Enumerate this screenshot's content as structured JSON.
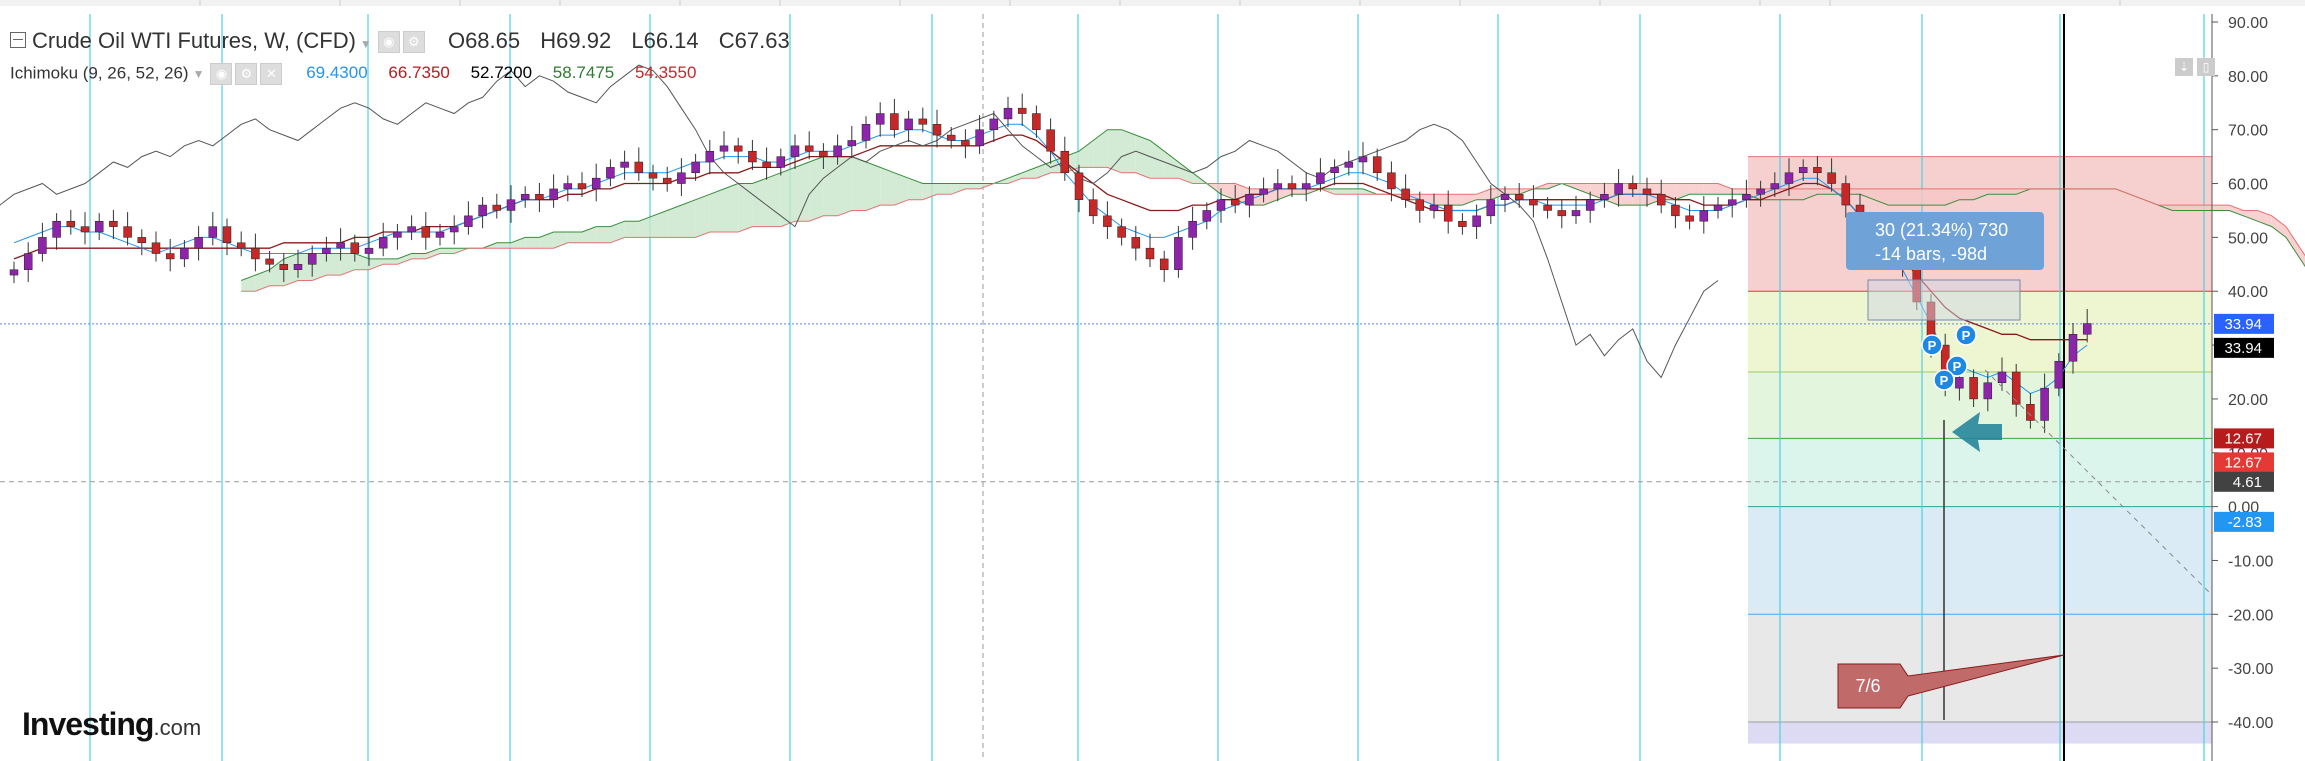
{
  "header": {
    "symbol_title": "Crude Oil WTI Futures, W, (CFD)",
    "ohlc": [
      {
        "key": "O",
        "value": "68.65"
      },
      {
        "key": "H",
        "value": "69.92"
      },
      {
        "key": "L",
        "value": "66.14"
      },
      {
        "key": "C",
        "value": "67.63"
      }
    ]
  },
  "indicator": {
    "name": "Ichimoku (9, 26, 52, 26)",
    "values": [
      {
        "value": "69.4300",
        "color": "#2196f3"
      },
      {
        "value": "66.7350",
        "color": "#b71c1c"
      },
      {
        "value": "52.7200",
        "color": "#000000"
      },
      {
        "value": "58.7475",
        "color": "#2e7d32"
      },
      {
        "value": "54.3550",
        "color": "#c62828"
      }
    ]
  },
  "brand": {
    "name": "Investing",
    "suffix": ".com"
  },
  "measure_label": {
    "line1": "30 (21.34%) 730",
    "line2": "-14 bars, -98d"
  },
  "callout": {
    "text": "7/6"
  },
  "markers": [
    "P",
    "P",
    "P",
    "P"
  ],
  "price_badges": [
    {
      "text": "33.94",
      "bg": "#2962ff",
      "value": 33.94,
      "offset": 0
    },
    {
      "text": "33.94",
      "bg": "#000000",
      "value": 33.94,
      "offset": 1
    },
    {
      "text": "12.67",
      "bg": "#b71c1c",
      "value": 12.67,
      "offset": 0
    },
    {
      "text": "12.67",
      "bg": "#e53935",
      "value": 12.67,
      "offset": 1
    },
    {
      "text": "4.61",
      "bg": "#424242",
      "value": 4.61,
      "offset": 0
    },
    {
      "text": "-2.83",
      "bg": "#2196f3",
      "value": -2.83,
      "offset": 0
    }
  ],
  "colors": {
    "bull": "#8e24aa",
    "bear": "#c62828",
    "tenkan": "#2196f3",
    "kijun": "#8b1a1a",
    "chikou": "#555555",
    "span_a": "#388e3c",
    "span_b": "#e57373",
    "cloud_bull": "#c8e6c9",
    "cloud_bear": "#f8c6c6",
    "cyan_lines": "#4dd0e1"
  },
  "chart_data": {
    "type": "candlestick",
    "title": "Crude Oil WTI Futures, W, (CFD)",
    "y_axis_side": "right",
    "ylim": [
      -44,
      91
    ],
    "yticks": [
      "90.00",
      "80.00",
      "70.00",
      "60.00",
      "50.00",
      "40.00",
      "30.00",
      "20.00",
      "10.00",
      "0.00",
      "-10.00",
      "-20.00",
      "-30.00",
      "-40.00"
    ],
    "close_series": [
      44,
      47,
      50,
      53,
      52,
      51,
      53,
      52,
      50,
      49,
      47,
      46,
      48,
      50,
      52,
      49,
      48,
      46,
      45,
      44,
      45,
      47,
      48,
      49,
      47,
      48,
      50,
      51,
      52,
      50,
      51,
      52,
      54,
      56,
      55,
      57,
      58,
      57,
      59,
      60,
      59,
      61,
      63,
      64,
      62,
      61,
      60,
      62,
      64,
      66,
      67,
      66,
      64,
      63,
      65,
      67,
      66,
      65,
      67,
      68,
      71,
      73,
      70,
      72,
      71,
      69,
      68,
      67,
      70,
      72,
      74,
      73,
      70,
      66,
      62,
      57,
      54,
      52,
      50,
      48,
      46,
      44,
      50,
      53,
      55,
      57,
      56,
      58,
      59,
      60,
      59,
      60,
      62,
      63,
      64,
      65,
      62,
      59,
      57,
      55,
      56,
      53,
      52,
      54,
      57,
      58,
      57,
      56,
      55,
      54,
      55,
      57,
      58,
      60,
      59,
      58,
      56,
      54,
      53,
      55,
      56,
      57,
      58,
      59,
      60,
      62,
      63,
      62,
      60,
      56,
      52,
      50,
      48,
      45,
      38,
      30,
      22,
      24,
      20,
      23,
      25,
      19,
      16,
      22,
      27,
      32,
      34
    ],
    "tenkan": [
      49,
      50,
      51,
      52,
      52,
      51,
      51,
      50,
      49,
      48,
      47,
      48,
      49,
      50,
      50,
      49,
      48,
      47,
      47,
      47,
      47,
      48,
      48,
      48,
      48,
      49,
      50,
      51,
      51,
      51,
      51,
      52,
      53,
      54,
      55,
      56,
      57,
      57,
      58,
      59,
      59,
      60,
      61,
      62,
      62,
      62,
      62,
      63,
      64,
      64,
      65,
      65,
      65,
      64,
      64,
      65,
      66,
      66,
      66,
      67,
      68,
      69,
      69,
      70,
      70,
      69,
      68,
      68,
      69,
      70,
      71,
      71,
      69,
      66,
      62,
      59,
      56,
      54,
      52,
      51,
      50,
      50,
      51,
      52,
      53,
      55,
      56,
      57,
      58,
      59,
      59,
      59,
      60,
      61,
      62,
      62,
      61,
      60,
      58,
      57,
      56,
      55,
      55,
      55,
      56,
      56,
      57,
      57,
      56,
      56,
      56,
      56,
      57,
      58,
      58,
      58,
      57,
      56,
      55,
      55,
      55,
      56,
      57,
      58,
      59,
      60,
      61,
      61,
      59,
      57,
      54,
      51,
      48,
      44,
      39,
      34,
      28,
      26,
      25,
      24,
      25,
      23,
      21,
      22,
      24,
      28,
      30
    ],
    "kijun": [
      46,
      47,
      48,
      48,
      48,
      48,
      48,
      48,
      48,
      48,
      48,
      48,
      48,
      48,
      48,
      48,
      48,
      48,
      48,
      49,
      49,
      49,
      49,
      49,
      50,
      50,
      51,
      51,
      51,
      52,
      52,
      52,
      53,
      54,
      55,
      56,
      57,
      57,
      57,
      58,
      58,
      59,
      59,
      60,
      60,
      60,
      60,
      61,
      61,
      62,
      62,
      62,
      63,
      63,
      63,
      64,
      65,
      65,
      65,
      65,
      66,
      67,
      67,
      67,
      67,
      67,
      67,
      67,
      67,
      68,
      69,
      69,
      68,
      66,
      64,
      62,
      60,
      58,
      57,
      56,
      55,
      55,
      55,
      56,
      56,
      57,
      57,
      58,
      58,
      59,
      59,
      59,
      59,
      60,
      60,
      60,
      59,
      58,
      57,
      56,
      55,
      55,
      55,
      55,
      56,
      56,
      57,
      57,
      57,
      57,
      57,
      57,
      57,
      58,
      58,
      58,
      58,
      57,
      57,
      56,
      56,
      56,
      57,
      57,
      58,
      59,
      60,
      60,
      59,
      57,
      54,
      51,
      48,
      46,
      43,
      40,
      37,
      35,
      34,
      33,
      32,
      32,
      31,
      31,
      31,
      31,
      31
    ],
    "cloud_a": [
      42,
      43,
      44,
      46,
      47,
      47,
      47,
      47,
      47,
      46,
      46,
      46,
      47,
      47,
      48,
      48,
      48,
      48,
      49,
      49,
      50,
      50,
      51,
      51,
      51,
      52,
      52,
      53,
      53,
      54,
      55,
      56,
      57,
      58,
      59,
      60,
      60,
      61,
      62,
      63,
      64,
      65,
      65,
      65,
      64,
      63,
      62,
      61,
      60,
      60,
      60,
      60,
      60,
      60,
      61,
      62,
      63,
      64,
      65,
      66,
      68,
      70,
      70,
      69,
      68,
      66,
      64,
      62,
      60,
      58,
      57,
      56,
      56,
      57,
      58,
      58,
      59,
      59,
      59,
      59,
      58,
      58,
      57,
      57,
      56,
      56,
      56,
      57,
      57,
      58,
      58,
      59,
      59,
      60,
      59,
      58,
      57,
      56,
      56,
      56,
      57,
      57,
      58,
      58,
      58,
      58,
      58,
      57,
      57,
      57,
      57,
      58,
      58,
      58,
      58,
      57,
      56,
      56,
      56,
      56,
      56,
      57,
      57,
      58,
      58,
      58,
      59,
      59,
      59,
      59,
      59,
      59,
      59,
      58,
      57,
      56,
      55,
      55,
      55,
      55,
      55,
      54,
      53,
      52,
      50,
      46,
      42
    ],
    "cloud_b": [
      40,
      40,
      41,
      41,
      42,
      42,
      43,
      43,
      44,
      44,
      45,
      45,
      46,
      46,
      47,
      47,
      48,
      48,
      48,
      48,
      48,
      48,
      48,
      49,
      49,
      49,
      49,
      50,
      50,
      50,
      50,
      50,
      50,
      51,
      51,
      51,
      52,
      52,
      52,
      53,
      53,
      54,
      54,
      55,
      55,
      56,
      56,
      57,
      57,
      58,
      58,
      59,
      59,
      60,
      60,
      61,
      61,
      62,
      62,
      63,
      63,
      63,
      62,
      62,
      61,
      61,
      61,
      60,
      60,
      60,
      60,
      59,
      59,
      59,
      59,
      59,
      59,
      58,
      58,
      58,
      58,
      58,
      58,
      58,
      58,
      58,
      58,
      58,
      59,
      59,
      59,
      59,
      60,
      60,
      60,
      60,
      60,
      60,
      60,
      60,
      60,
      60,
      60,
      60,
      60,
      59,
      59,
      59,
      59,
      59,
      59,
      59,
      59,
      59,
      59,
      59,
      59,
      59,
      59,
      59,
      59,
      59,
      59,
      59,
      59,
      59,
      59,
      59,
      59,
      59,
      59,
      59,
      59,
      58,
      57,
      56,
      56,
      56,
      56,
      56,
      56,
      55,
      55,
      54,
      52,
      48,
      44
    ]
  }
}
